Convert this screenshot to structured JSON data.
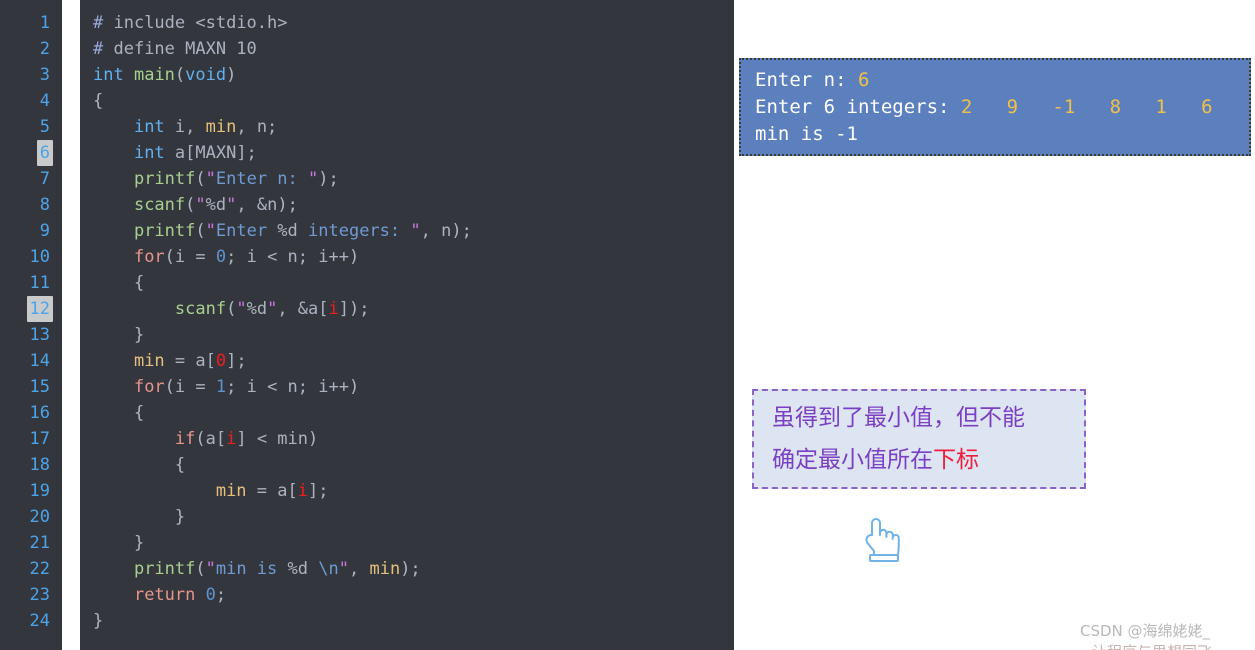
{
  "editor": {
    "background_color": "#33373d",
    "gutter_color": "#33373d",
    "line_number_color": "#4da3e8",
    "highlighted_lines": [
      6,
      12
    ],
    "line_numbers": [
      "1",
      "2",
      "3",
      "4",
      "5",
      "6",
      "7",
      "8",
      "9",
      "10",
      "11",
      "12",
      "13",
      "14",
      "15",
      "16",
      "17",
      "18",
      "19",
      "20",
      "21",
      "22",
      "23",
      "24"
    ],
    "code_lines": [
      "# include <stdio.h>",
      "# define MAXN 10",
      "int main(void)",
      "{",
      "    int i, min, n;",
      "    int a[MAXN];",
      "    printf(\"Enter n: \");",
      "    scanf(\"%d\", &n);",
      "    printf(\"Enter %d integers: \", n);",
      "    for(i = 0; i < n; i++)",
      "    {",
      "        scanf(\"%d\", &a[i]);",
      "    }",
      "    min = a[0];",
      "    for(i = 1; i < n; i++)",
      "    {",
      "        if(a[i] < min)",
      "        {",
      "            min = a[i];",
      "        }",
      "    }",
      "    printf(\"min is %d \\n\", min);",
      "    return 0;",
      "}"
    ],
    "language": "c",
    "syntax_colors": {
      "keyword": "#61afef",
      "control": "#e8948c",
      "function": "#a8cf8e",
      "variable": "#e5c07b",
      "string": "#6f9ad3",
      "quote": "#c678dd",
      "number": "#5f93cf",
      "plain": "#abb2bf",
      "highlighted_index": "#ef1d1d"
    }
  },
  "terminal": {
    "background_color": "#5c7fbd",
    "text_color": "#ffffff",
    "input_color": "#f0c04a",
    "lines": [
      {
        "prompt": "Enter n: ",
        "input": "6"
      },
      {
        "prompt": "Enter 6 integers: ",
        "input": "2   9   -1   8   1   6"
      },
      {
        "prompt": "min is -1",
        "input": ""
      }
    ],
    "entered_n": "6",
    "entered_integers": [
      "2",
      "9",
      "-1",
      "8",
      "1",
      "6"
    ],
    "result": "min is -1"
  },
  "callout": {
    "background_color": "#dde5f2",
    "border_color": "#8a63c4",
    "text_color": "#7b3fc4",
    "emphasis_color": "#ef1d3a",
    "line1": "虽得到了最小值，但不能",
    "line2_prefix": "确定最小值所在",
    "line2_emphasis": "下标"
  },
  "pointer": {
    "icon": "pointing-up-hand-icon",
    "color": "#6fb3e8"
  },
  "watermark": {
    "text": "CSDN @海绵姥姥_",
    "text_secondary": "让程序与思想同飞",
    "color": "#b9b9b9"
  }
}
